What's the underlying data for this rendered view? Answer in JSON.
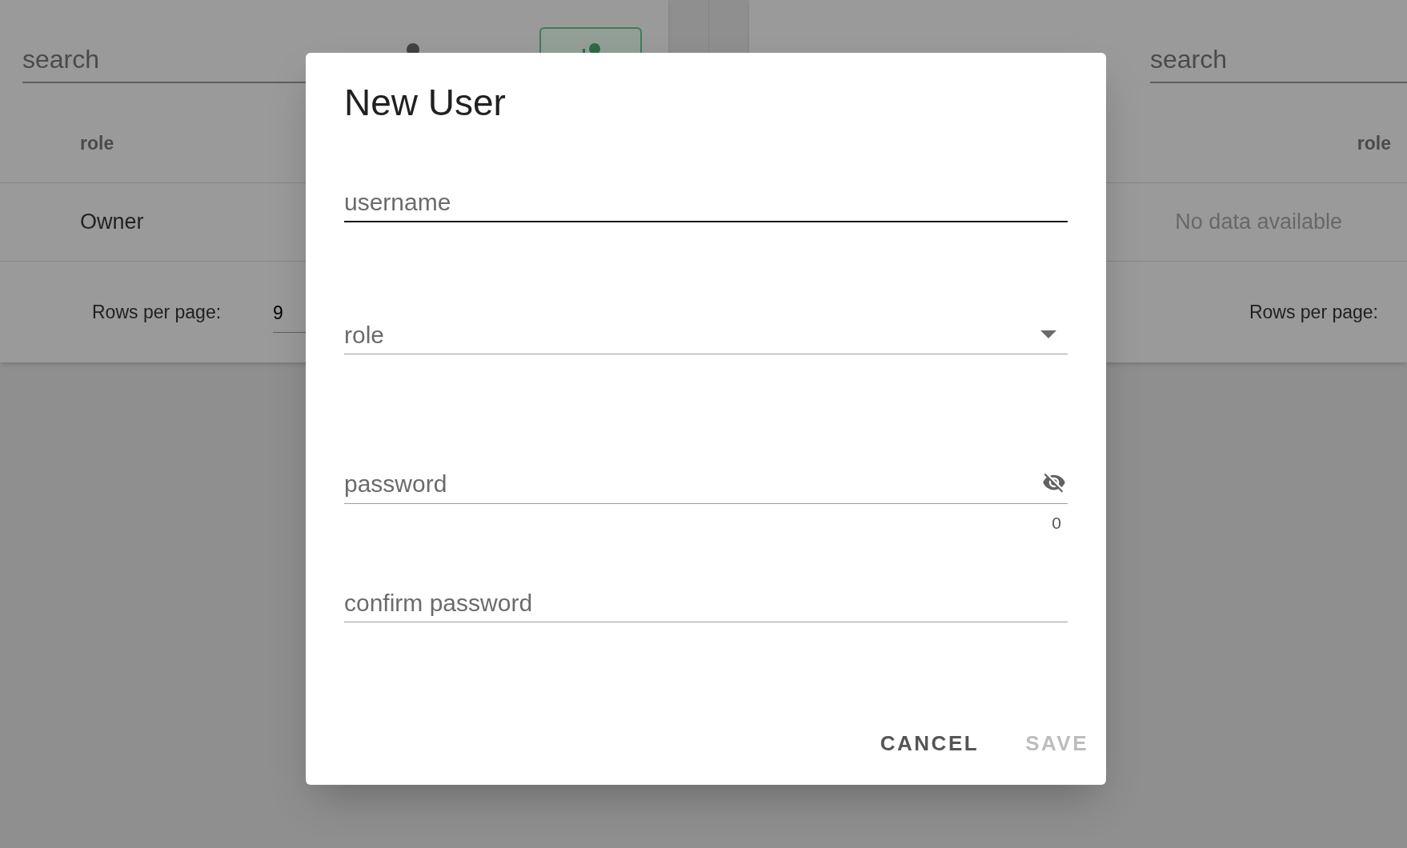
{
  "background": {
    "users_panel": {
      "search": {
        "placeholder": "search"
      },
      "table": {
        "columns": [
          "role"
        ],
        "rows": [
          [
            "Owner"
          ]
        ]
      },
      "footer": {
        "rows_per_page_label": "Rows per page:",
        "rows_per_page_value": "9"
      }
    },
    "ldap_panel": {
      "search": {
        "placeholder": "search"
      },
      "table": {
        "columns": [
          "role"
        ],
        "empty_text": "No data available"
      },
      "footer": {
        "rows_per_page_label": "Rows per page:"
      }
    }
  },
  "dialog": {
    "title": "New User",
    "fields": [
      {
        "kind": "text",
        "placeholder": "username",
        "focused": true
      },
      {
        "kind": "select",
        "placeholder": "role",
        "focused": false
      },
      {
        "kind": "secret",
        "placeholder": "password",
        "focused": false,
        "counter": "0"
      },
      {
        "kind": "text",
        "placeholder": "confirm password",
        "focused": false
      }
    ],
    "buttons": [
      {
        "label": "CANCEL",
        "disabled": false
      },
      {
        "label": "SAVE",
        "disabled": true
      }
    ]
  }
}
